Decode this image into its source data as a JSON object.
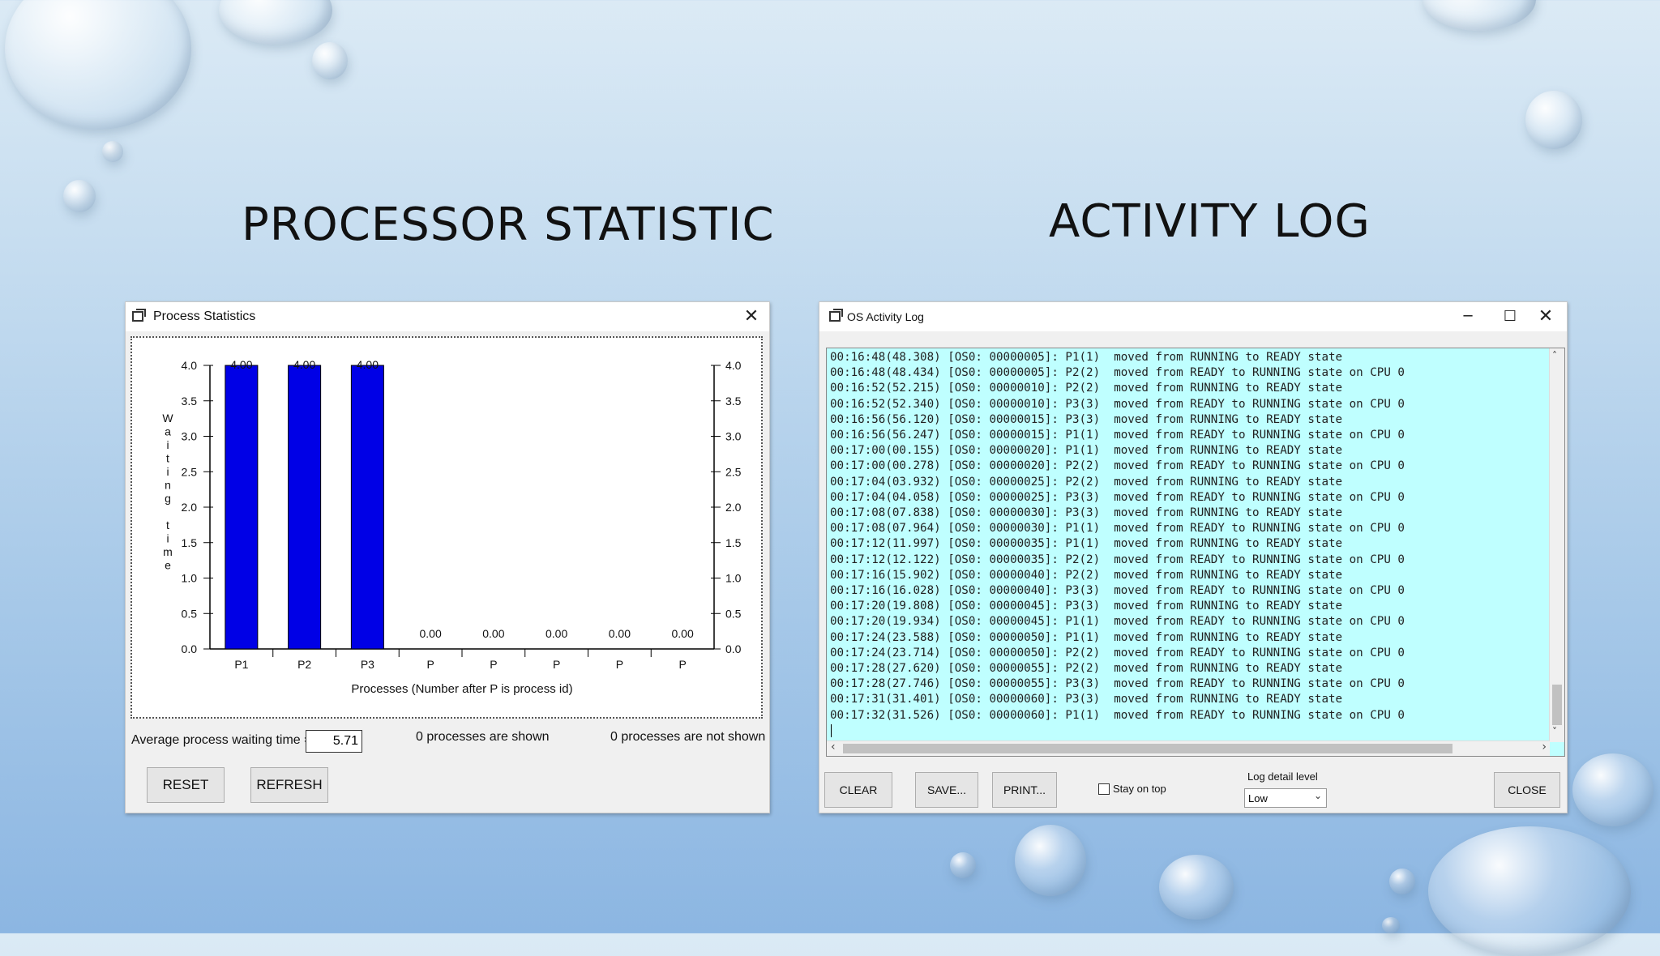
{
  "slide": {
    "left_heading": "PROCESSOR STATISTIC",
    "right_heading": "ACTIVITY LOG"
  },
  "stats_window": {
    "title": "Process Statistics",
    "avg_label": "Average process waiting time =",
    "avg_value": "5.71",
    "shown_text": "0 processes are shown",
    "not_shown_text": "0 processes are not shown",
    "reset_label": "RESET",
    "refresh_label": "REFRESH"
  },
  "chart_data": {
    "type": "bar",
    "categories": [
      "P1",
      "P2",
      "P3",
      "P",
      "P",
      "P",
      "P",
      "P"
    ],
    "values": [
      4.0,
      4.0,
      4.0,
      0.0,
      0.0,
      0.0,
      0.0,
      0.0
    ],
    "data_labels": [
      "4.00",
      "4.00",
      "4.00",
      "0.00",
      "0.00",
      "0.00",
      "0.00",
      "0.00"
    ],
    "xlabel": "Processes (Number after P is process id)",
    "ylabel": "Waiting time",
    "ylim": [
      0,
      4.0
    ],
    "yticks": [
      "0.0",
      "0.5",
      "1.0",
      "1.5",
      "2.0",
      "2.5",
      "3.0",
      "3.5",
      "4.0"
    ],
    "bar_color": "#0000e6",
    "grid": false,
    "legend": "none"
  },
  "log_window": {
    "title": "OS Activity Log",
    "lines": [
      "00:16:48(48.308) [OS0: 00000005]: P1(1)  moved from RUNNING to READY state",
      "00:16:48(48.434) [OS0: 00000005]: P2(2)  moved from READY to RUNNING state on CPU 0",
      "00:16:52(52.215) [OS0: 00000010]: P2(2)  moved from RUNNING to READY state",
      "00:16:52(52.340) [OS0: 00000010]: P3(3)  moved from READY to RUNNING state on CPU 0",
      "00:16:56(56.120) [OS0: 00000015]: P3(3)  moved from RUNNING to READY state",
      "00:16:56(56.247) [OS0: 00000015]: P1(1)  moved from READY to RUNNING state on CPU 0",
      "00:17:00(00.155) [OS0: 00000020]: P1(1)  moved from RUNNING to READY state",
      "00:17:00(00.278) [OS0: 00000020]: P2(2)  moved from READY to RUNNING state on CPU 0",
      "00:17:04(03.932) [OS0: 00000025]: P2(2)  moved from RUNNING to READY state",
      "00:17:04(04.058) [OS0: 00000025]: P3(3)  moved from READY to RUNNING state on CPU 0",
      "00:17:08(07.838) [OS0: 00000030]: P3(3)  moved from RUNNING to READY state",
      "00:17:08(07.964) [OS0: 00000030]: P1(1)  moved from READY to RUNNING state on CPU 0",
      "00:17:12(11.997) [OS0: 00000035]: P1(1)  moved from RUNNING to READY state",
      "00:17:12(12.122) [OS0: 00000035]: P2(2)  moved from READY to RUNNING state on CPU 0",
      "00:17:16(15.902) [OS0: 00000040]: P2(2)  moved from RUNNING to READY state",
      "00:17:16(16.028) [OS0: 00000040]: P3(3)  moved from READY to RUNNING state on CPU 0",
      "00:17:20(19.808) [OS0: 00000045]: P3(3)  moved from RUNNING to READY state",
      "00:17:20(19.934) [OS0: 00000045]: P1(1)  moved from READY to RUNNING state on CPU 0",
      "00:17:24(23.588) [OS0: 00000050]: P1(1)  moved from RUNNING to READY state",
      "00:17:24(23.714) [OS0: 00000050]: P2(2)  moved from READY to RUNNING state on CPU 0",
      "00:17:28(27.620) [OS0: 00000055]: P2(2)  moved from RUNNING to READY state",
      "00:17:28(27.746) [OS0: 00000055]: P3(3)  moved from READY to RUNNING state on CPU 0",
      "00:17:31(31.401) [OS0: 00000060]: P3(3)  moved from RUNNING to READY state",
      "00:17:32(31.526) [OS0: 00000060]: P1(1)  moved from READY to RUNNING state on CPU 0"
    ],
    "clear_label": "CLEAR",
    "save_label": "SAVE...",
    "print_label": "PRINT...",
    "stay_on_top_label": "Stay on top",
    "stay_on_top_checked": false,
    "log_detail_label": "Log detail level",
    "log_detail_value": "Low",
    "close_label": "CLOSE",
    "background_color": "#bfffff"
  }
}
